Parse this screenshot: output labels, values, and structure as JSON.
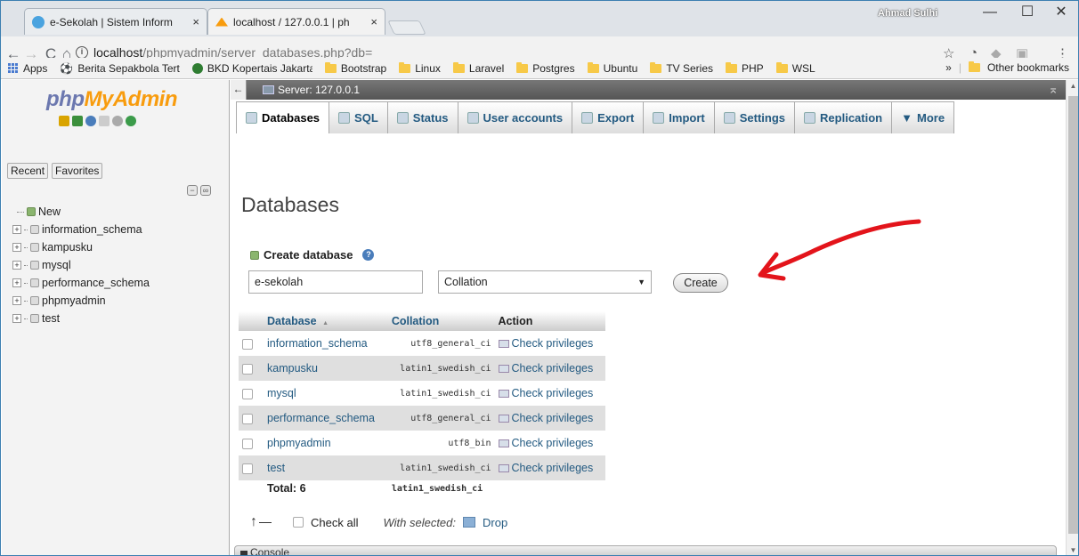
{
  "browser": {
    "tabs": [
      {
        "title": "e-Sekolah | Sistem Inform",
        "close": "×"
      },
      {
        "title": "localhost / 127.0.0.1 | ph",
        "close": "×"
      }
    ],
    "profile_name": "Ahmad Sulhi",
    "window_controls": {
      "minimize": "—",
      "maximize": "☐",
      "close": "✕"
    },
    "nav": {
      "back": "←",
      "forward": "→",
      "reload": "C",
      "home": "⌂"
    },
    "url_host": "localhost",
    "url_path": "/phpmyadmin/server_databases.php?db=",
    "bookmarks": [
      {
        "label": "Apps",
        "icon": "apps-grid-icon"
      },
      {
        "label": "Berita Sepakbola Tert",
        "icon": "soccer-icon"
      },
      {
        "label": "BKD Kopertais Jakarta",
        "icon": "emblem-icon"
      },
      {
        "label": "Bootstrap",
        "icon": "folder-icon"
      },
      {
        "label": "Linux",
        "icon": "folder-icon"
      },
      {
        "label": "Laravel",
        "icon": "folder-icon"
      },
      {
        "label": "Postgres",
        "icon": "folder-icon"
      },
      {
        "label": "Ubuntu",
        "icon": "folder-icon"
      },
      {
        "label": "TV Series",
        "icon": "folder-icon"
      },
      {
        "label": "PHP",
        "icon": "folder-icon"
      },
      {
        "label": "WSL",
        "icon": "folder-icon"
      }
    ],
    "bookmarks_overflow": "»",
    "other_bookmarks": "Other bookmarks"
  },
  "pma": {
    "logo_php": "php",
    "logo_myadmin": "MyAdmin",
    "recent": "Recent",
    "favorites": "Favorites",
    "tree": [
      {
        "label": "New",
        "type": "new"
      },
      {
        "label": "information_schema",
        "type": "db"
      },
      {
        "label": "kampusku",
        "type": "db"
      },
      {
        "label": "mysql",
        "type": "db"
      },
      {
        "label": "performance_schema",
        "type": "db"
      },
      {
        "label": "phpmyadmin",
        "type": "db"
      },
      {
        "label": "test",
        "type": "db"
      }
    ],
    "server_label": "Server: 127.0.0.1",
    "menu": [
      {
        "label": "Databases",
        "active": true
      },
      {
        "label": "SQL",
        "active": false
      },
      {
        "label": "Status",
        "active": false
      },
      {
        "label": "User accounts",
        "active": false
      },
      {
        "label": "Export",
        "active": false
      },
      {
        "label": "Import",
        "active": false
      },
      {
        "label": "Settings",
        "active": false
      },
      {
        "label": "Replication",
        "active": false
      },
      {
        "label": "More",
        "active": false
      }
    ],
    "page_title": "Databases",
    "create_db_label": "Create database",
    "create_input_value": "e-sekolah",
    "collation_placeholder": "Collation",
    "create_button": "Create",
    "table": {
      "headers": {
        "database": "Database",
        "sort_indicator": "▲",
        "collation": "Collation",
        "action": "Action"
      },
      "rows": [
        {
          "name": "information_schema",
          "collation": "utf8_general_ci",
          "action": "Check privileges"
        },
        {
          "name": "kampusku",
          "collation": "latin1_swedish_ci",
          "action": "Check privileges"
        },
        {
          "name": "mysql",
          "collation": "latin1_swedish_ci",
          "action": "Check privileges"
        },
        {
          "name": "performance_schema",
          "collation": "utf8_general_ci",
          "action": "Check privileges"
        },
        {
          "name": "phpmyadmin",
          "collation": "utf8_bin",
          "action": "Check privileges"
        },
        {
          "name": "test",
          "collation": "latin1_swedish_ci",
          "action": "Check privileges"
        }
      ],
      "total_label": "Total: 6",
      "total_collation": "latin1_swedish_ci"
    },
    "check_all": "Check all",
    "with_selected": "With selected:",
    "drop": "Drop",
    "console": "Console"
  },
  "colors": {
    "annotation_arrow": "#e3141b",
    "link": "#235a81"
  }
}
